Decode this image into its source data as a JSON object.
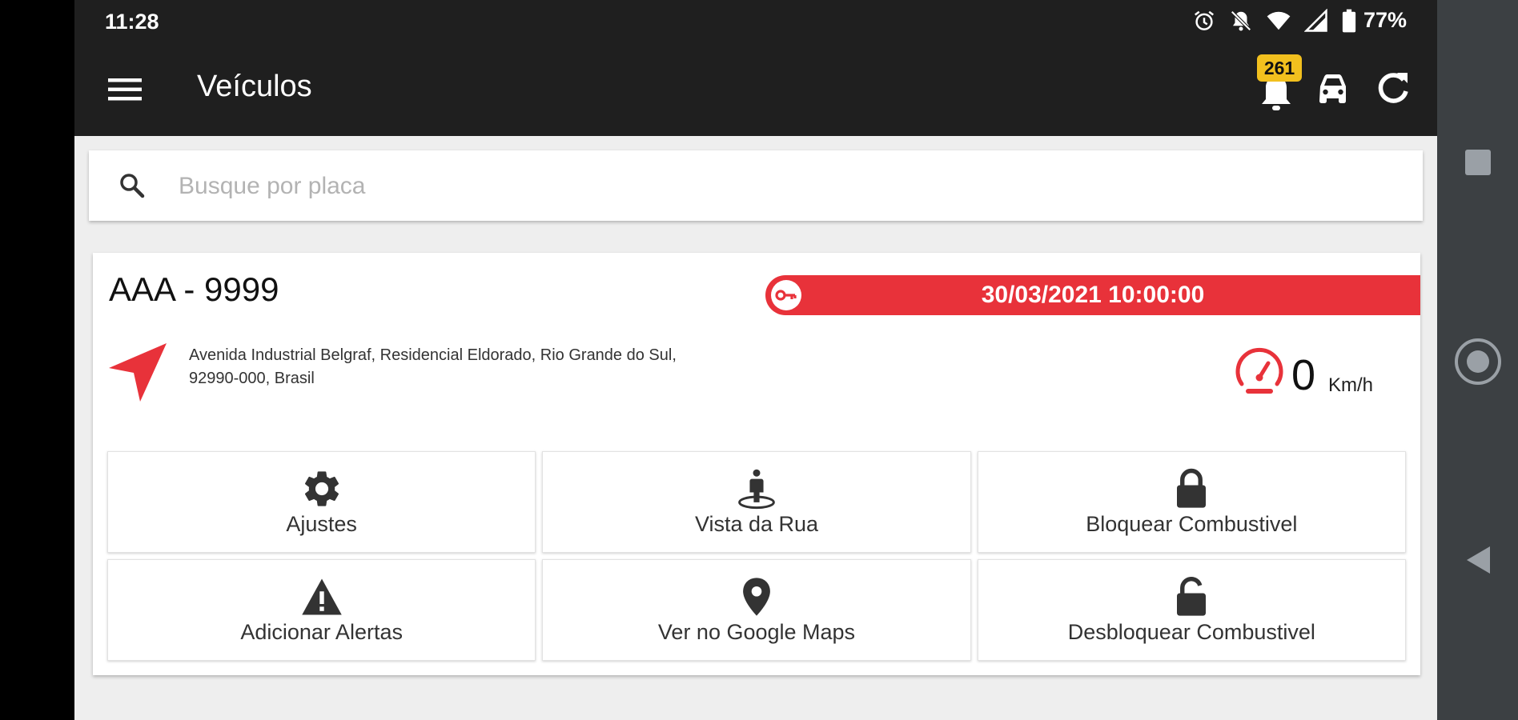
{
  "status_bar": {
    "time": "11:28",
    "battery_percent": "77%"
  },
  "app_bar": {
    "title": "Veículos",
    "notification_count": "261"
  },
  "search": {
    "placeholder": "Busque por placa",
    "value": ""
  },
  "vehicle": {
    "plate": "AAA - 9999",
    "ignition_datetime": "30/03/2021 10:00:00",
    "address_line1": "Avenida Industrial Belgraf, Residencial Eldorado, Rio Grande do Sul,",
    "address_line2": "92990-000, Brasil",
    "speed_value": "0",
    "speed_unit": "Km/h"
  },
  "actions": [
    {
      "label": "Ajustes",
      "icon": "gear-icon"
    },
    {
      "label": "Vista da Rua",
      "icon": "street-view-icon"
    },
    {
      "label": "Bloquear Combustivel",
      "icon": "lock-icon"
    },
    {
      "label": "Adicionar Alertas",
      "icon": "warning-icon"
    },
    {
      "label": "Ver no Google Maps",
      "icon": "map-pin-icon"
    },
    {
      "label": "Desbloquear Combustivel",
      "icon": "unlock-icon"
    }
  ],
  "colors": {
    "app_bar": "#1f1f1f",
    "accent_red": "#e8323a",
    "badge_yellow": "#f2c01e",
    "icon_dark": "#333333",
    "nav_rail": "#3c4043"
  }
}
